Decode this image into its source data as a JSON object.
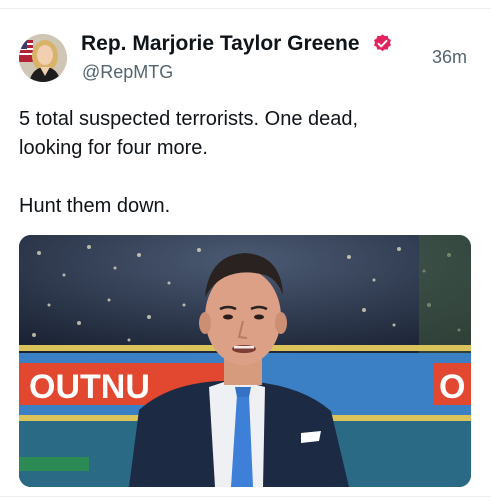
{
  "post": {
    "author_name": "Rep. Marjorie Taylor Greene",
    "handle": "@RepMTG",
    "time_ago": "36m",
    "text": "5 total suspected terrorists. One dead,\nlooking for four more.\n\nHunt them down.",
    "verified": true,
    "badge_color": "#e0245e"
  },
  "media": {
    "banner_left_text": "OUTNU",
    "banner_right_text": "O"
  }
}
